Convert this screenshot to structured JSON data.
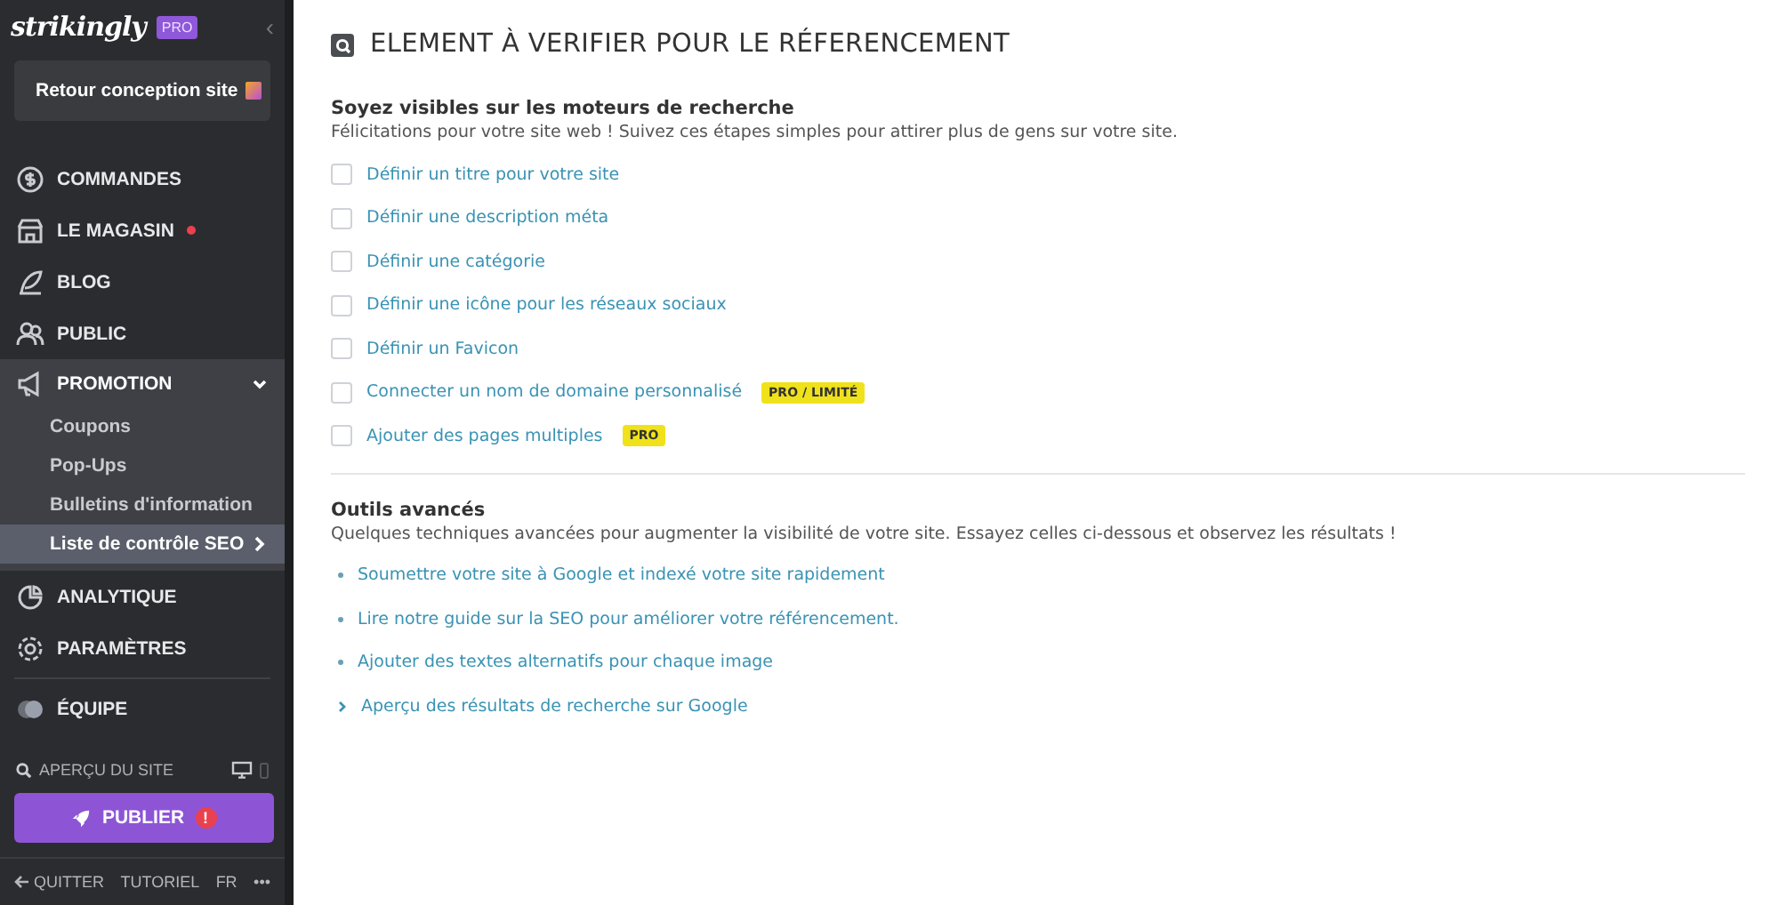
{
  "sidebar": {
    "logo": "strikingly",
    "plan_badge": "PRO",
    "collapse": "‹",
    "back_button": "Retour conception site",
    "nav": [
      {
        "label": "COMMANDES",
        "alert": false,
        "expanded": false,
        "selected": false
      },
      {
        "label": "LE MAGASIN",
        "alert": true,
        "expanded": false,
        "selected": false
      },
      {
        "label": "BLOG",
        "alert": false,
        "expanded": false,
        "selected": false
      },
      {
        "label": "PUBLIC",
        "alert": false,
        "expanded": false,
        "selected": false
      },
      {
        "label": "PROMOTION",
        "alert": false,
        "expanded": true,
        "selected": false,
        "children": [
          {
            "label": "Coupons",
            "selected": false
          },
          {
            "label": "Pop-Ups",
            "selected": false
          },
          {
            "label": "Bulletins d'information",
            "selected": false
          },
          {
            "label": "Liste de contrôle SEO",
            "selected": true
          }
        ]
      },
      {
        "label": "ANALYTIQUE",
        "alert": false,
        "expanded": false,
        "selected": false
      },
      {
        "label": "PARAMÈTRES",
        "alert": false,
        "expanded": false,
        "selected": false
      },
      {
        "label": "ÉQUIPE",
        "alert": false,
        "expanded": false,
        "selected": false
      }
    ],
    "preview": "APERÇU DU SITE",
    "publish_button": "PUBLIER",
    "publish_alert": "!",
    "footer": [
      "QUITTER",
      "TUTORIEL",
      "FR",
      "•••"
    ]
  },
  "main": {
    "title": "ELEMENT À VERIFIER POUR LE RÉFERENCEMENT",
    "section_1": {
      "heading": "Soyez visibles sur les moteurs de recherche",
      "intro": "Félicitations pour votre site web ! Suivez ces étapes simples pour attirer plus de gens sur votre site.",
      "tasks": [
        {
          "label": "Définir un titre pour votre site",
          "checked": false
        },
        {
          "label": "Définir une description méta",
          "checked": false
        },
        {
          "label": "Définir une catégorie",
          "checked": false
        },
        {
          "label": "Définir une icône pour les réseaux sociaux",
          "checked": false
        },
        {
          "label": "Définir un Favicon",
          "checked": false
        },
        {
          "label": "Connecter un nom de domaine personnalisé",
          "checked": false,
          "badge": "PRO / LIMITÉ"
        },
        {
          "label": "Ajouter des pages multiples",
          "checked": false,
          "badge": "PRO"
        }
      ]
    },
    "section_2": {
      "heading": "Outils avancés",
      "intro": "Quelques techniques avancées pour augmenter la visibilité de votre site. Essayez celles ci-dessous et observez les résultats !",
      "links": [
        {
          "label": "Soumettre votre site à Google et indexé votre site rapidement",
          "kind": "bullet"
        },
        {
          "label": "Lire notre guide sur la SEO pour améliorer votre référencement.",
          "kind": "bullet"
        },
        {
          "label": "Ajouter des textes alternatifs pour chaque image",
          "kind": "bullet"
        },
        {
          "label": "Aperçu des résultats de recherche sur Google",
          "kind": "expand"
        }
      ]
    }
  }
}
